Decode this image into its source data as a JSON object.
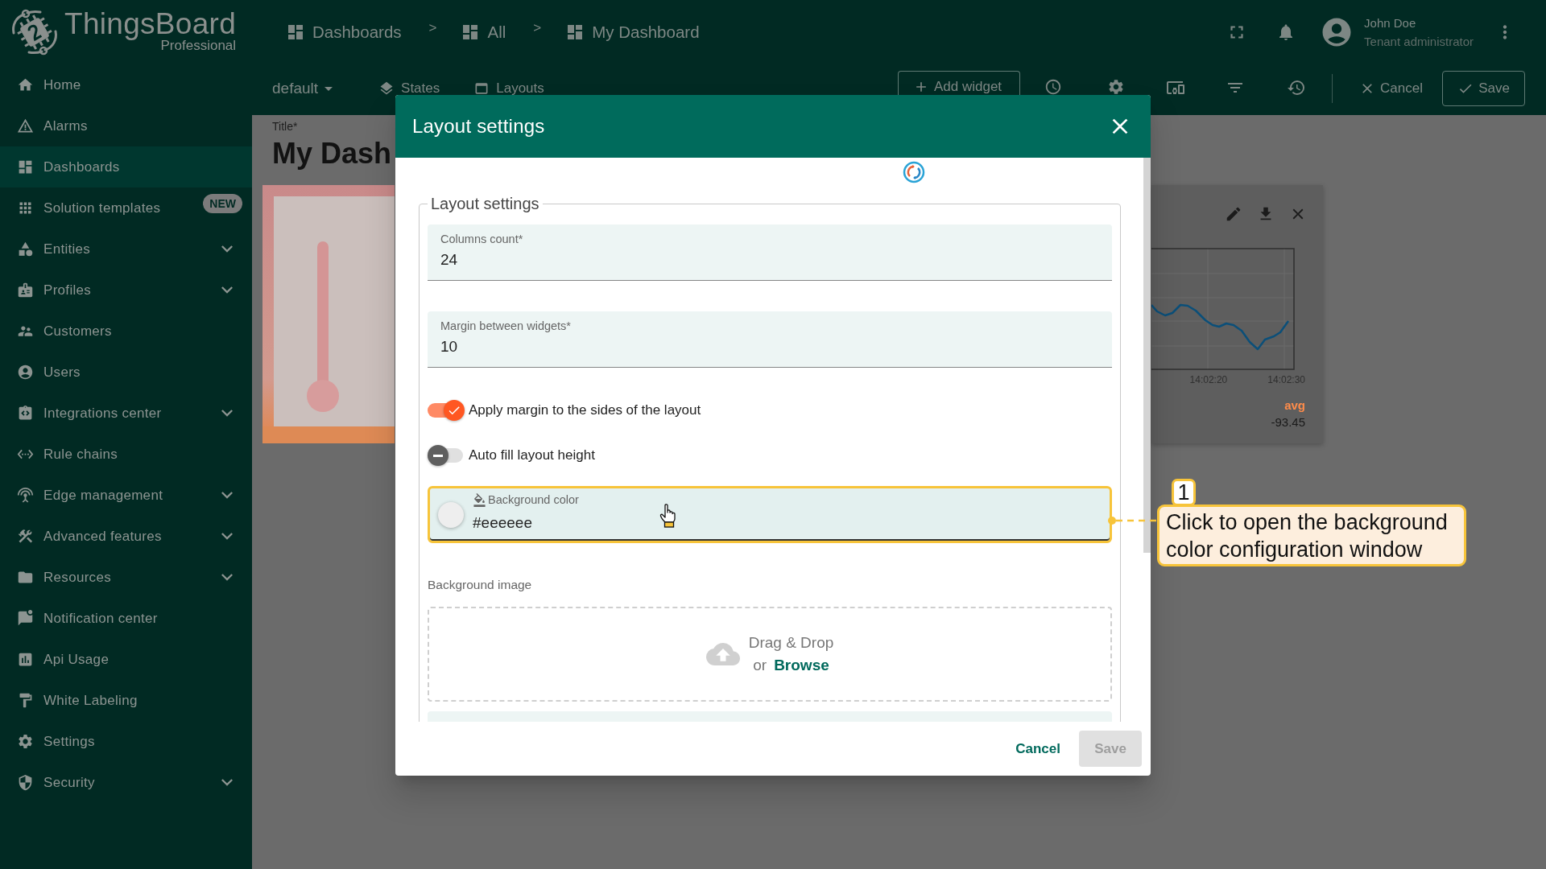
{
  "sidebar": {
    "logo": {
      "title": "ThingsBoard",
      "subtitle": "Professional"
    },
    "items": [
      {
        "label": "Home",
        "kind": "page",
        "selected": false
      },
      {
        "label": "Alarms",
        "kind": "page",
        "selected": false
      },
      {
        "label": "Dashboards",
        "kind": "page",
        "selected": true
      },
      {
        "label": "Solution templates",
        "kind": "page",
        "selected": false,
        "badge": "NEW"
      },
      {
        "label": "Entities",
        "kind": "group",
        "selected": false,
        "expanded": false
      },
      {
        "label": "Profiles",
        "kind": "group",
        "selected": false,
        "expanded": false
      },
      {
        "label": "Customers",
        "kind": "page",
        "selected": false
      },
      {
        "label": "Users",
        "kind": "page",
        "selected": false
      },
      {
        "label": "Integrations center",
        "kind": "group",
        "selected": false,
        "expanded": false
      },
      {
        "label": "Rule chains",
        "kind": "page",
        "selected": false
      },
      {
        "label": "Edge management",
        "kind": "group",
        "selected": false,
        "expanded": false
      },
      {
        "label": "Advanced features",
        "kind": "group",
        "selected": false,
        "expanded": false
      },
      {
        "label": "Resources",
        "kind": "group",
        "selected": false,
        "expanded": false
      },
      {
        "label": "Notification center",
        "kind": "page",
        "selected": false
      },
      {
        "label": "Api Usage",
        "kind": "page",
        "selected": false
      },
      {
        "label": "White Labeling",
        "kind": "page",
        "selected": false
      },
      {
        "label": "Settings",
        "kind": "page",
        "selected": false
      },
      {
        "label": "Security",
        "kind": "group",
        "selected": false,
        "expanded": false
      }
    ]
  },
  "header": {
    "breadcrumbs": [
      {
        "label": "Dashboards"
      },
      {
        "separator": ">",
        "label": "All"
      },
      {
        "separator": ">",
        "label": "My Dashboard"
      }
    ],
    "user": {
      "name": "John Doe",
      "role": "Tenant administrator"
    }
  },
  "toolbar": {
    "layout": "default",
    "tools": [
      {
        "label": "States"
      },
      {
        "label": "Layouts"
      }
    ],
    "add_widget": "Add widget",
    "cancel": "Cancel",
    "save": "Save"
  },
  "dashboard": {
    "title_label": "Title*",
    "title": "My Dash",
    "chart_widget": {
      "x_ticks": [
        "14:02:20",
        "14:02:30"
      ],
      "legend_label": "avg",
      "legend_value": "-93.45"
    }
  },
  "dialog": {
    "title": "Layout settings",
    "section_title": "Layout settings",
    "fields": [
      {
        "label": "Columns count*",
        "value": "24"
      },
      {
        "label": "Margin between widgets*",
        "value": "10"
      }
    ],
    "toggles": [
      {
        "label": "Apply margin to the sides of the layout",
        "on": true
      },
      {
        "label": "Auto fill layout height",
        "on": false
      }
    ],
    "background_color": {
      "label": "Background color",
      "value": "#eeeeee",
      "color": "#eeeeee",
      "highlighted": true
    },
    "background_image": {
      "label": "Background image",
      "drop_text": "Drag & Drop",
      "or_text": "or",
      "link": "Browse"
    },
    "buttons": [
      {
        "label": "Cancel",
        "disabled": false
      },
      {
        "label": "Save",
        "disabled": true
      }
    ]
  },
  "callout": {
    "number": "1",
    "text": "Click to open the background color configuration window"
  }
}
